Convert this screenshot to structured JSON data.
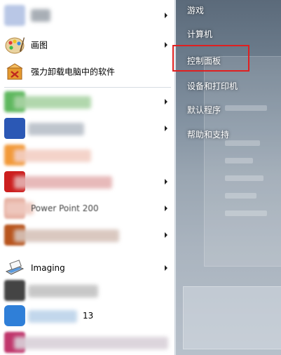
{
  "left_menu": {
    "items": [
      {
        "label": "",
        "has_arrow": true
      },
      {
        "label": "画图",
        "has_arrow": true
      },
      {
        "label": "强力卸载电脑中的软件",
        "has_arrow": false
      },
      {
        "label": "",
        "has_arrow": true
      },
      {
        "label": "",
        "has_arrow": true
      },
      {
        "label": "",
        "has_arrow": false
      },
      {
        "label": "",
        "has_arrow": true
      },
      {
        "label": "Power Point 200",
        "has_arrow": true
      },
      {
        "label": "",
        "has_arrow": true
      },
      {
        "label": "Imaging",
        "has_arrow": true
      },
      {
        "label": "",
        "has_arrow": false
      },
      {
        "label": "13",
        "has_arrow": false
      },
      {
        "label": "",
        "has_arrow": false
      }
    ]
  },
  "right_menu": {
    "items": [
      {
        "label": "游戏"
      },
      {
        "label": "计算机"
      },
      {
        "label": "控制面板"
      },
      {
        "label": "设备和打印机"
      },
      {
        "label": "默认程序"
      },
      {
        "label": "帮助和支持"
      }
    ]
  },
  "colors": {
    "highlight_border": "#e02020",
    "right_pane_text": "#ffffff"
  }
}
